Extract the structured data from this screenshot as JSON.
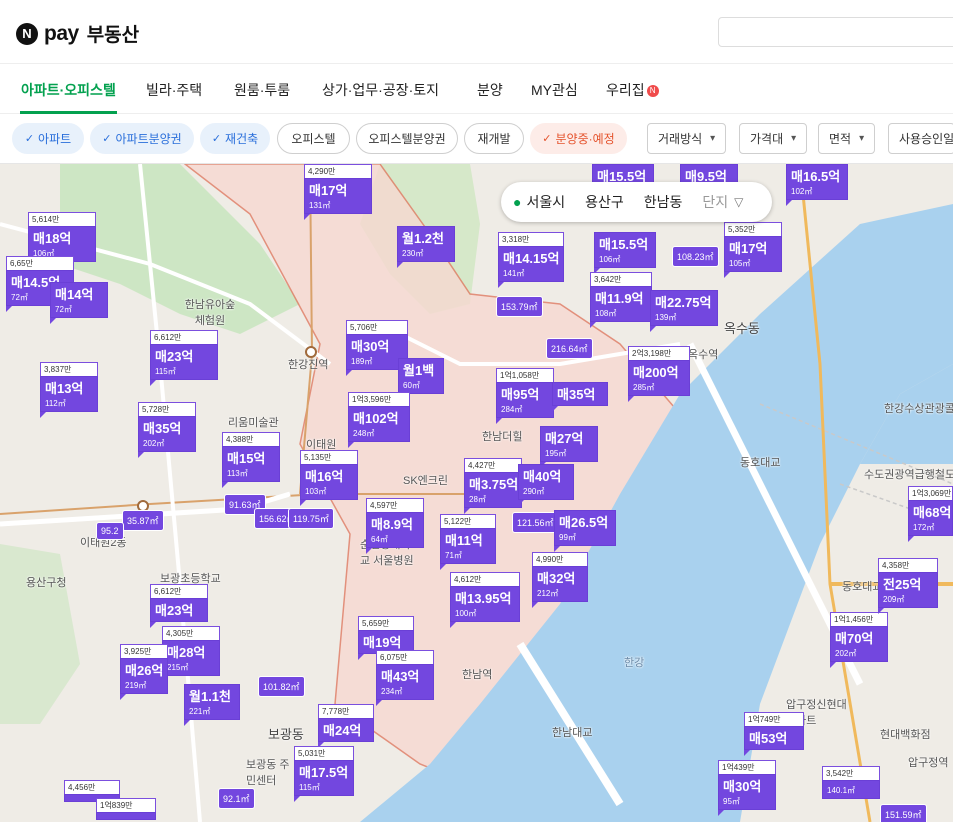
{
  "header": {
    "logo_letter": "N",
    "logo_pay": "pay",
    "service_title": "부동산",
    "search_placeholder": ""
  },
  "category_tabs": [
    {
      "label": "아파트·오피스텔",
      "active": true
    },
    {
      "label": "빌라·주택",
      "active": false
    },
    {
      "label": "원룸·투룸",
      "active": false
    },
    {
      "label": "상가·업무·공장·토지",
      "active": false
    },
    {
      "label": "분양",
      "active": false
    },
    {
      "label": "MY관심",
      "active": false
    },
    {
      "label": "우리집",
      "active": false,
      "badge": "N"
    }
  ],
  "filter_chips": [
    {
      "label": "아파트",
      "state": "on"
    },
    {
      "label": "아파트분양권",
      "state": "on"
    },
    {
      "label": "재건축",
      "state": "on"
    },
    {
      "label": "오피스텔",
      "state": "off"
    },
    {
      "label": "오피스텔분양권",
      "state": "off"
    },
    {
      "label": "재개발",
      "state": "off"
    },
    {
      "label": "분양중·예정",
      "state": "warn"
    }
  ],
  "filter_dropdowns": [
    {
      "label": "거래방식"
    },
    {
      "label": "가격대"
    },
    {
      "label": "면적"
    },
    {
      "label": "사용승인일"
    }
  ],
  "location": {
    "city": "서울시",
    "district": "용산구",
    "dong": "한남동",
    "complex": "단지"
  },
  "map_places": [
    {
      "name": "한강진역"
    },
    {
      "name": "이태원"
    },
    {
      "name": "리움미술관"
    },
    {
      "name": "SK엔크린"
    },
    {
      "name": "순천향대학교 서울병원"
    },
    {
      "name": "한남역"
    },
    {
      "name": "한남대교"
    },
    {
      "name": "한강"
    },
    {
      "name": "옥수동"
    },
    {
      "name": "옥수역"
    },
    {
      "name": "동호대교"
    },
    {
      "name": "동호대교"
    },
    {
      "name": "압구정역"
    },
    {
      "name": "압구정신현대 아파트"
    },
    {
      "name": "현대백화점"
    },
    {
      "name": "보광동"
    },
    {
      "name": "보광동 주민센터"
    },
    {
      "name": "보광초등학교"
    },
    {
      "name": "용산구청"
    },
    {
      "name": "한남유아숲 체험원"
    },
    {
      "name": "한강수상관광콜택시"
    },
    {
      "name": "수도권광역급행철도"
    },
    {
      "name": "이태원2동"
    },
    {
      "name": "한남더힐"
    }
  ],
  "markers": [
    {
      "top": "4,290만",
      "price": "매17억",
      "area": "131㎡"
    },
    {
      "top": "5,614만",
      "price": "매18억",
      "area": "106㎡"
    },
    {
      "top": "6,65만",
      "price": "매14.5억",
      "area": "72㎡"
    },
    {
      "top": "",
      "price": "매14억",
      "area": "72㎡"
    },
    {
      "top": "",
      "price": "월1.2천",
      "area": "230㎡"
    },
    {
      "top": "6,612만",
      "price": "매23억",
      "area": "115㎡"
    },
    {
      "top": "3,837만",
      "price": "매13억",
      "area": "112㎡"
    },
    {
      "top": "5,706만",
      "price": "매30억",
      "area": "189㎡"
    },
    {
      "top": "",
      "price": "월1백",
      "area": "60㎡"
    },
    {
      "top": "1억3,596만",
      "price": "매102억",
      "area": "248㎡"
    },
    {
      "top": "5,728만",
      "price": "매35억",
      "area": "202㎡"
    },
    {
      "top": "4,388만",
      "price": "매15억",
      "area": "113㎡"
    },
    {
      "top": "5,135만",
      "price": "매16억",
      "area": "103㎡"
    },
    {
      "top": "4,597만",
      "price": "매8.9억",
      "area": "64㎡"
    },
    {
      "top": "3,318만",
      "price": "매14.15억",
      "area": "141㎡"
    },
    {
      "top": "",
      "price": "매15.5억",
      "area": "106㎡"
    },
    {
      "top": "3,642만",
      "price": "매11.9억",
      "area": "108㎡"
    },
    {
      "top": "",
      "price": "매22.75억",
      "area": "139㎡"
    },
    {
      "top": "5,352만",
      "price": "매17억",
      "area": "105㎡"
    },
    {
      "top": "",
      "price": "매9.5억",
      "area": ""
    },
    {
      "top": "",
      "price": "매16.5억",
      "area": "102㎡"
    },
    {
      "top": "",
      "price": "매15.5억",
      "area": ""
    },
    {
      "top": "1억1,058만",
      "price": "매95억",
      "area": "284㎡"
    },
    {
      "top": "",
      "price": "매35억",
      "area": ""
    },
    {
      "top": "2억3,198만",
      "price": "매200억",
      "area": "285㎡"
    },
    {
      "top": "",
      "price": "매27억",
      "area": "195㎡"
    },
    {
      "top": "4,427만",
      "price": "매3.75억",
      "area": "28㎡"
    },
    {
      "top": "",
      "price": "매40억",
      "area": "290㎡"
    },
    {
      "top": "",
      "price": "매26.5억",
      "area": "99㎡"
    },
    {
      "top": "5,122만",
      "price": "매11억",
      "area": "71㎡"
    },
    {
      "top": "4,990만",
      "price": "매32억",
      "area": "212㎡"
    },
    {
      "top": "4,612만",
      "price": "매13.95억",
      "area": "100㎡"
    },
    {
      "top": "6,612만",
      "price": "매23억",
      "area": ""
    },
    {
      "top": "4,305만",
      "price": "매28억",
      "area": "215㎡"
    },
    {
      "top": "3,925만",
      "price": "매26억",
      "area": "219㎡"
    },
    {
      "top": "",
      "price": "월1.1천",
      "area": "221㎡"
    },
    {
      "top": "5,659만",
      "price": "매19억",
      "area": ""
    },
    {
      "top": "6,075만",
      "price": "매43억",
      "area": "234㎡"
    },
    {
      "top": "7,778만",
      "price": "매24억",
      "area": ""
    },
    {
      "top": "5,031만",
      "price": "매17.5억",
      "area": "115㎡"
    },
    {
      "top": "1억749만",
      "price": "매53억",
      "area": ""
    },
    {
      "top": "1억439만",
      "price": "매30억",
      "area": "95㎡"
    },
    {
      "top": "1억1,456만",
      "price": "매70억",
      "area": "202㎡"
    },
    {
      "top": "4,358만",
      "price": "전25억",
      "area": "209㎡"
    },
    {
      "top": "1억3,069만",
      "price": "매68억",
      "area": "172㎡"
    },
    {
      "top": "3,542만",
      "price": "",
      "area": "140.1㎡"
    },
    {
      "top": "4,456만",
      "price": "",
      "area": ""
    },
    {
      "top": "1억839만",
      "price": "",
      "area": ""
    }
  ],
  "small_badges": [
    {
      "label": "35.87㎡"
    },
    {
      "label": "95.2"
    },
    {
      "label": "91.63㎡"
    },
    {
      "label": "156.62㎡"
    },
    {
      "label": "119.75㎡"
    },
    {
      "label": "101.82㎡"
    },
    {
      "label": "92.1㎡"
    },
    {
      "label": "153.79㎡"
    },
    {
      "label": "216.64㎡"
    },
    {
      "label": "108.23㎡"
    },
    {
      "label": "121.56㎡"
    },
    {
      "label": "151.59㎡"
    }
  ]
}
